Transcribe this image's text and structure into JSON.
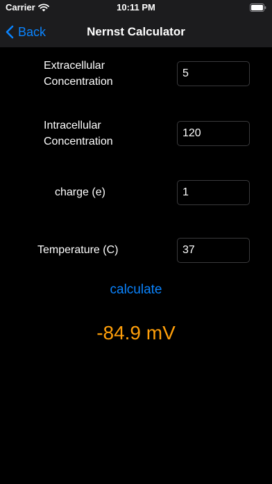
{
  "status_bar": {
    "carrier": "Carrier",
    "time": "10:11 PM",
    "wifi_icon": "wifi-icon",
    "battery_icon": "battery-icon"
  },
  "nav": {
    "back_label": "Back",
    "back_icon": "chevron-left-icon",
    "title": "Nernst Calculator"
  },
  "form": {
    "extracellular": {
      "label_line1": "Extracellular",
      "label_line2": "Concentration",
      "value": "5"
    },
    "intracellular": {
      "label_line1": "Intracellular",
      "label_line2": "Concentration",
      "value": "120"
    },
    "charge": {
      "label": "charge (e)",
      "value": "1"
    },
    "temperature": {
      "label": "Temperature (C)",
      "value": "37"
    }
  },
  "calculate_label": "calculate",
  "result": "-84.9 mV",
  "colors": {
    "accent": "#0a84ff",
    "result": "#ff9f0a",
    "background": "#000000",
    "bar": "#1c1c1e"
  }
}
